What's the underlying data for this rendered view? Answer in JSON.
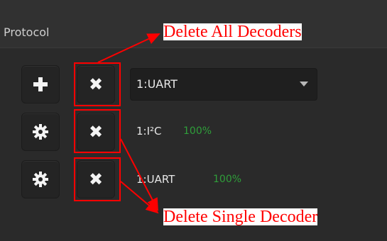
{
  "panel": {
    "title": "Protocol"
  },
  "toolbar": {
    "add_icon": "plus-icon",
    "delete_all_icon": "close-icon",
    "selected_protocol": "1:UART",
    "dropdown_icon": "chevron-down-icon"
  },
  "decoders": [
    {
      "name": "1:I²C",
      "progress": "100%",
      "settings_icon": "gear-icon",
      "delete_icon": "close-icon"
    },
    {
      "name": "1:UART",
      "progress": "100%",
      "settings_icon": "gear-icon",
      "delete_icon": "close-icon"
    }
  ],
  "annotations": {
    "delete_all": "Delete All Decoders",
    "delete_single": "Delete Single Decoder",
    "color": "#ff0000"
  },
  "colors": {
    "background": "#2a2a2a",
    "button": "#242424",
    "progress_text": "#2f9e3a"
  }
}
